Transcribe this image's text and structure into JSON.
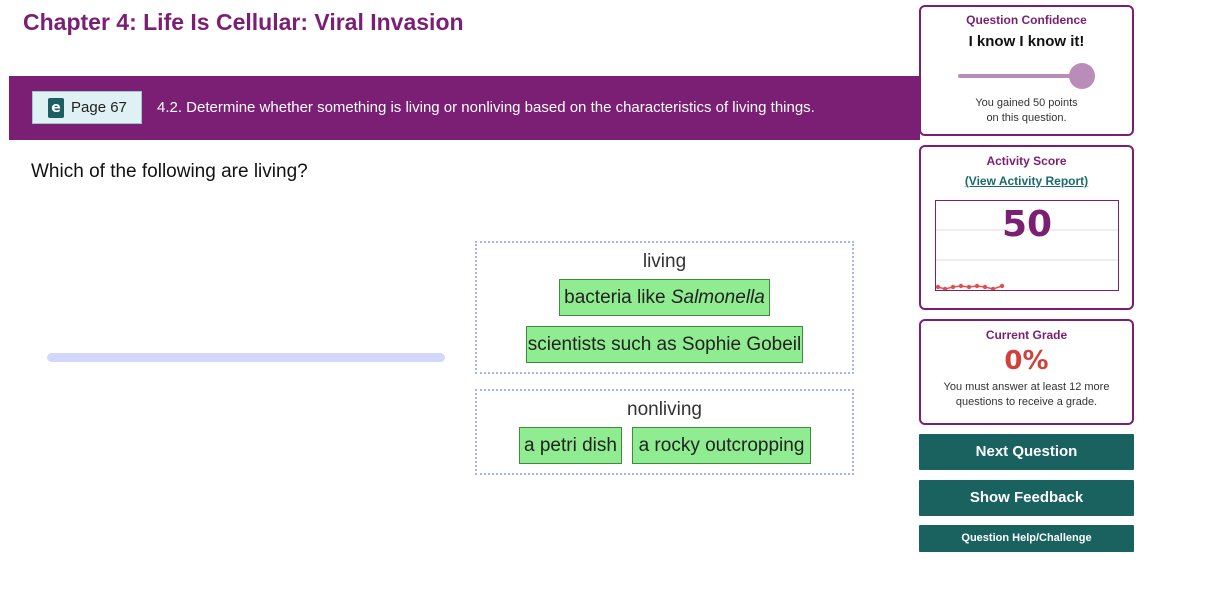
{
  "header": {
    "chapter_title": "Chapter 4: Life Is Cellular: Viral Invasion"
  },
  "banner": {
    "book_icon": "ebook-icon",
    "page_label": "Page 67",
    "standard_text": "4.2. Determine whether something is living or nonliving based on the characteristics of living things."
  },
  "question": {
    "text": "Which of the following are living?",
    "progress_fraction": 0
  },
  "categories": {
    "living": {
      "title": "living",
      "items": [
        {
          "prefix": "bacteria like ",
          "italic": "Salmonella"
        },
        {
          "text": "scientists such as Sophie Gobeil"
        }
      ]
    },
    "nonliving": {
      "title": "nonliving",
      "items": [
        {
          "text": "a petri dish"
        },
        {
          "text": "a rocky outcropping"
        }
      ]
    }
  },
  "confidence": {
    "title": "Question Confidence",
    "value": "I know I know it!",
    "slider_level": 1.0,
    "note_line1": "You gained 50 points",
    "note_line2": "on this question."
  },
  "activity_score": {
    "title": "Activity Score",
    "report_link": "(View Activity Report)",
    "score": "50",
    "sparkline_color": "#d9534f"
  },
  "current_grade": {
    "title": "Current Grade",
    "value": "0%",
    "note_line1": "You must answer at least 12 more",
    "note_line2": "questions to receive a grade."
  },
  "buttons": {
    "next": "Next Question",
    "feedback": "Show Feedback",
    "help": "Question Help/Challenge"
  },
  "colors": {
    "brand_purple": "#7a1f74",
    "button_teal": "#19625f",
    "chip_green": "#90ec90",
    "grade_red": "#d0413b"
  }
}
